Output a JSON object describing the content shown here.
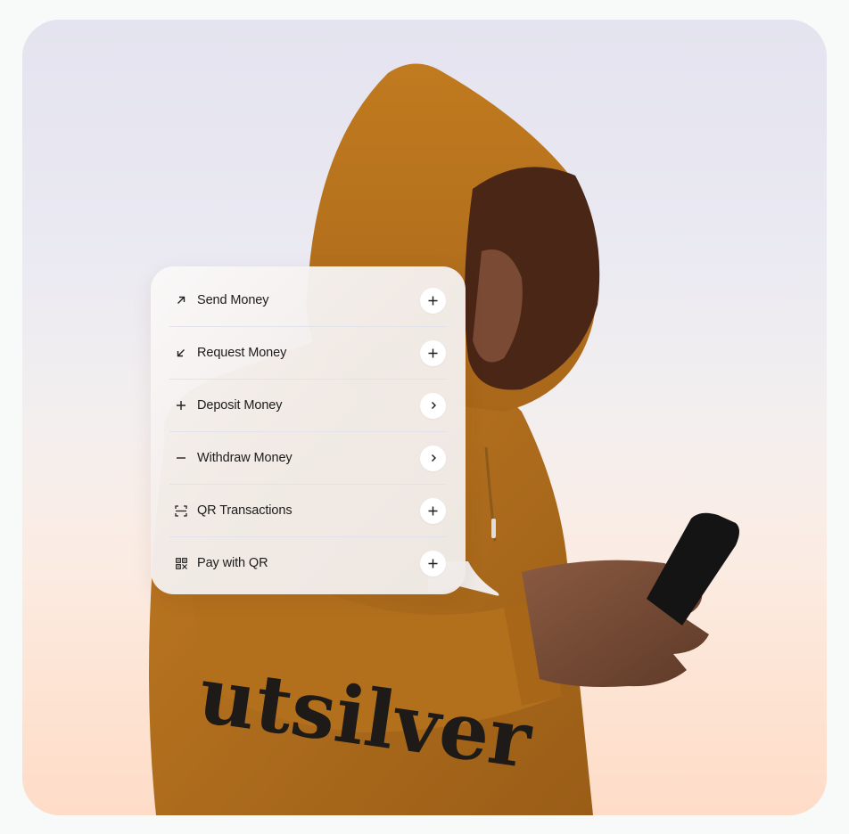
{
  "hero": {
    "image_description": "Person in mustard hoodie with sleeve lettering, looking at a smartphone against a pastel sky",
    "sleeve_text": "utsilver"
  },
  "action_menu": {
    "items": [
      {
        "label": "Send Money",
        "icon": "arrow-up-right-icon",
        "action_icon": "plus-icon"
      },
      {
        "label": "Request Money",
        "icon": "arrow-down-left-icon",
        "action_icon": "plus-icon"
      },
      {
        "label": "Deposit Money",
        "icon": "plus-icon",
        "action_icon": "chevron-right-icon"
      },
      {
        "label": "Withdraw Money",
        "icon": "minus-icon",
        "action_icon": "chevron-right-icon"
      },
      {
        "label": "QR Transactions",
        "icon": "scan-frame-icon",
        "action_icon": "plus-icon"
      },
      {
        "label": "Pay with QR",
        "icon": "qr-code-icon",
        "action_icon": "plus-icon"
      }
    ]
  },
  "colors": {
    "page_background": "#f8f9f9",
    "sky_top": "#e4e3ef",
    "sky_bottom": "#fedcc8",
    "hoodie": "#b8741e",
    "card_background": "#f3eeec",
    "text": "#1c1c1c"
  }
}
